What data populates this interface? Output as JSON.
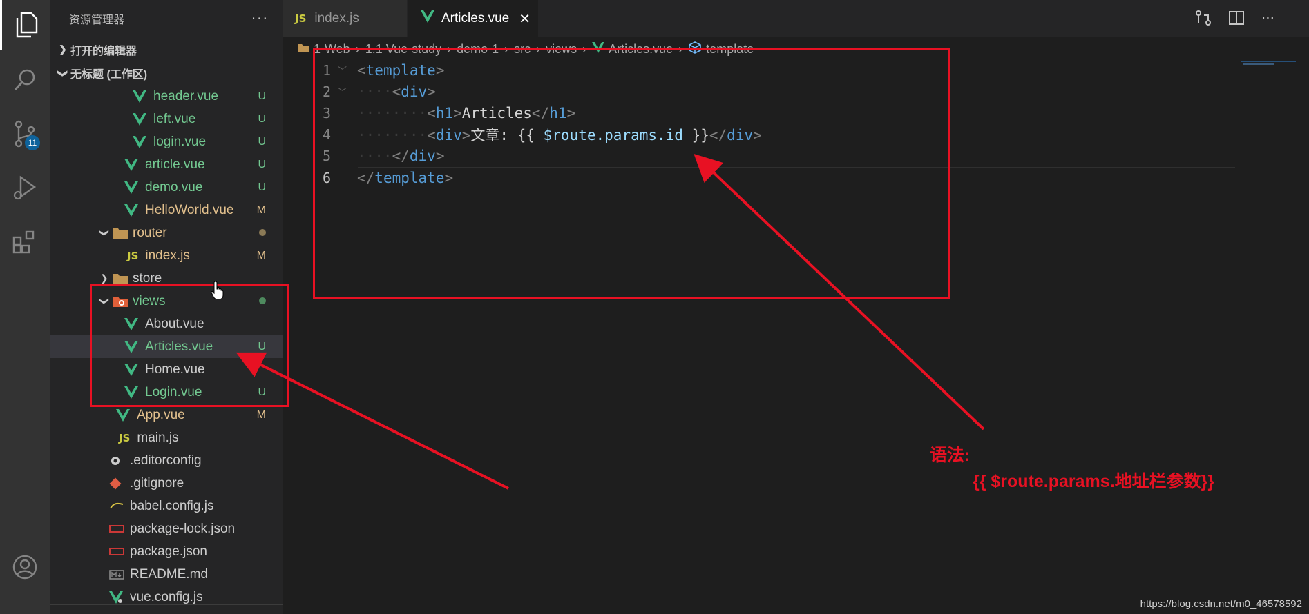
{
  "activity": {
    "badge": "11",
    "items": [
      "explorer-icon",
      "search-icon",
      "source-control-icon",
      "run-debug-icon",
      "extensions-icon",
      "account-icon"
    ]
  },
  "sidebar": {
    "title": "资源管理器",
    "more": "···",
    "open_editors": "打开的编辑器",
    "workspace": "无标题 (工作区)",
    "items": [
      {
        "label": "header.vue",
        "status": "U"
      },
      {
        "label": "left.vue",
        "status": "U"
      },
      {
        "label": "login.vue",
        "status": "U"
      },
      {
        "label": "article.vue",
        "status": "U"
      },
      {
        "label": "demo.vue",
        "status": "U"
      },
      {
        "label": "HelloWorld.vue",
        "status": "M"
      },
      {
        "label": "router",
        "status": ""
      },
      {
        "label": "index.js",
        "status": "M"
      },
      {
        "label": "store",
        "status": ""
      },
      {
        "label": "views",
        "status": ""
      },
      {
        "label": "About.vue",
        "status": ""
      },
      {
        "label": "Articles.vue",
        "status": "U"
      },
      {
        "label": "Home.vue",
        "status": ""
      },
      {
        "label": "Login.vue",
        "status": "U"
      },
      {
        "label": "App.vue",
        "status": "M"
      },
      {
        "label": "main.js",
        "status": ""
      },
      {
        "label": ".editorconfig",
        "status": ""
      },
      {
        "label": ".gitignore",
        "status": ""
      },
      {
        "label": "babel.config.js",
        "status": ""
      },
      {
        "label": "package-lock.json",
        "status": ""
      },
      {
        "label": "package.json",
        "status": ""
      },
      {
        "label": "README.md",
        "status": ""
      },
      {
        "label": "vue.config.js",
        "status": ""
      }
    ]
  },
  "tabs": [
    {
      "label": "index.js",
      "badge": "JS"
    },
    {
      "label": "Articles.vue",
      "close": "✕"
    }
  ],
  "breadcrumb": [
    "1-Web",
    "1.1 Vue-study",
    "demo-1",
    "src",
    "views",
    "Articles.vue",
    "template"
  ],
  "code": {
    "lines": [
      "1",
      "2",
      "3",
      "4",
      "5",
      "6"
    ],
    "l1_tag": "template",
    "l2_tag": "div",
    "l3_tag": "h1",
    "l3_text": "Articles",
    "l4_tag": "div",
    "l4_text": "文章: ",
    "l4_open": "{{ ",
    "l4_expr": "$route.params.id",
    "l4_close": " }}",
    "l5_tag": "div",
    "l6_tag": "template"
  },
  "annotation": {
    "title": "语法:",
    "code": "{{ $route.params.地址栏参数}}"
  },
  "watermark": "https://blog.csdn.net/m0_46578592",
  "colors": {
    "annotation": "#e81123",
    "untracked": "#73c991",
    "modified": "#e2c08d",
    "vue": "#41b883"
  }
}
